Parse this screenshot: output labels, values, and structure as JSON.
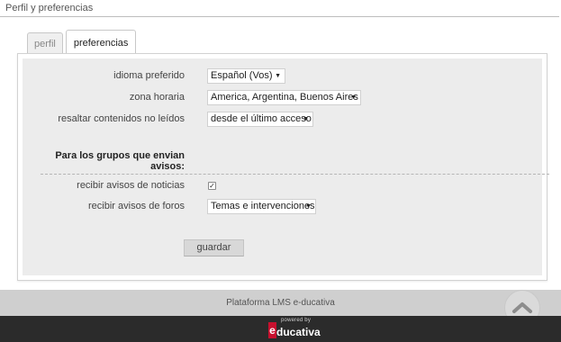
{
  "page": {
    "title": "Perfil y preferencias"
  },
  "tabs": [
    {
      "label": "perfil",
      "active": false
    },
    {
      "label": "preferencias",
      "active": true
    }
  ],
  "form": {
    "language": {
      "label": "idioma preferido",
      "value": "Español (Vos)"
    },
    "timezone": {
      "label": "zona horaria",
      "value": "America, Argentina, Buenos Aires"
    },
    "highlight": {
      "label": "resaltar contenidos no leídos",
      "value": "desde el último acceso"
    },
    "group_heading": "Para los grupos que envian avisos:",
    "news_alerts": {
      "label": "recibir avisos de noticias",
      "checked": true
    },
    "forum_alerts": {
      "label": "recibir avisos de foros",
      "value": "Temas e intervenciones"
    },
    "save_label": "guardar"
  },
  "footer": {
    "platform_text": "Plataforma LMS e-ducativa",
    "logo_powered": "powered by",
    "logo_e": "e",
    "logo_word": "ducativa"
  },
  "colors": {
    "accent_red": "#c8102e",
    "footer_dark": "#2b2b2b"
  },
  "icons": {
    "dropdown": "chevron-down-icon",
    "checkbox": "check-icon",
    "scroll_top": "chevron-up-icon"
  }
}
